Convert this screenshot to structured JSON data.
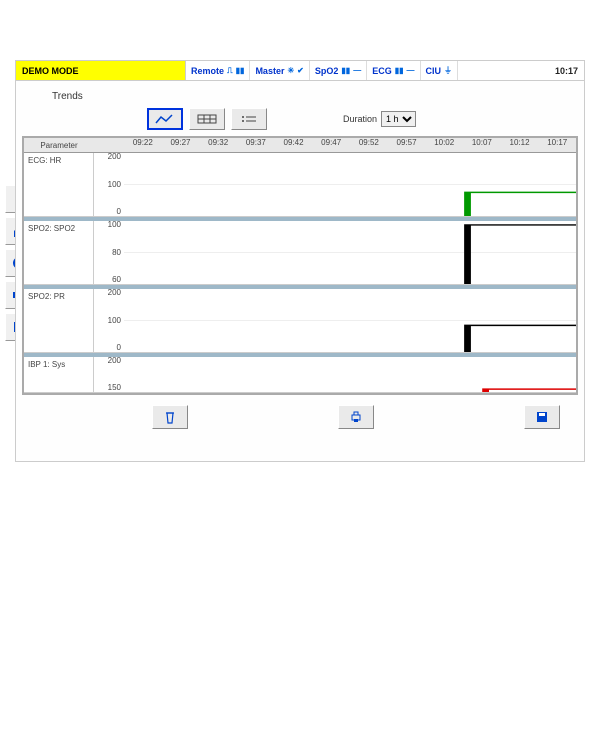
{
  "topbar": {
    "demo_mode": "DEMO MODE",
    "remote": "Remote",
    "master": "Master",
    "spo2": "SpO2",
    "ecg": "ECG",
    "ciu": "CIU",
    "clock": "10:17"
  },
  "title": "Trends",
  "toolbar": {
    "view_graph_icon": "graph-icon",
    "view_table_icon": "table-icon",
    "view_list_icon": "list-icon",
    "duration_label": "Duration",
    "duration_value": "1 h"
  },
  "time_axis": [
    "09:22",
    "09:27",
    "09:32",
    "09:37",
    "09:42",
    "09:47",
    "09:52",
    "09:57",
    "10:02",
    "10:07",
    "10:12",
    "10:17"
  ],
  "params": {
    "header": "Parameter",
    "ecg": {
      "label": "ECG: HR",
      "ticks": [
        "200",
        "100",
        "0"
      ]
    },
    "spo2": {
      "label": "SPO2: SPO2",
      "ticks": [
        "100",
        "80",
        "60"
      ]
    },
    "pr": {
      "label": "SPO2: PR",
      "ticks": [
        "200",
        "100",
        "0"
      ]
    },
    "ibp": {
      "label": "IBP 1: Sys",
      "ticks": [
        "200",
        "150"
      ]
    }
  },
  "chart_data": [
    {
      "type": "line",
      "name": "ECG: HR",
      "x_start": "10:04",
      "x_end": "10:17",
      "value": 75,
      "ylim": [
        0,
        200
      ],
      "color": "#009900"
    },
    {
      "type": "line",
      "name": "SPO2: SPO2",
      "x_start": "10:04",
      "x_end": "10:17",
      "value": 98,
      "ylim": [
        60,
        100
      ],
      "color": "#000000"
    },
    {
      "type": "line",
      "name": "SPO2: PR",
      "x_start": "10:04",
      "x_end": "10:17",
      "value": 85,
      "ylim": [
        0,
        200
      ],
      "color": "#000000"
    },
    {
      "type": "line",
      "name": "IBP 1: Sys",
      "x_start": "10:06",
      "x_end": "10:17",
      "value": 135,
      "ylim": [
        100,
        200
      ],
      "color": "#dd0000"
    }
  ],
  "left_icons": [
    "patient-icon",
    "home-icon",
    "settings-icon",
    "bed-icon",
    "folder-icon"
  ],
  "footer": [
    "delete-icon",
    "print-icon",
    "save-icon"
  ]
}
